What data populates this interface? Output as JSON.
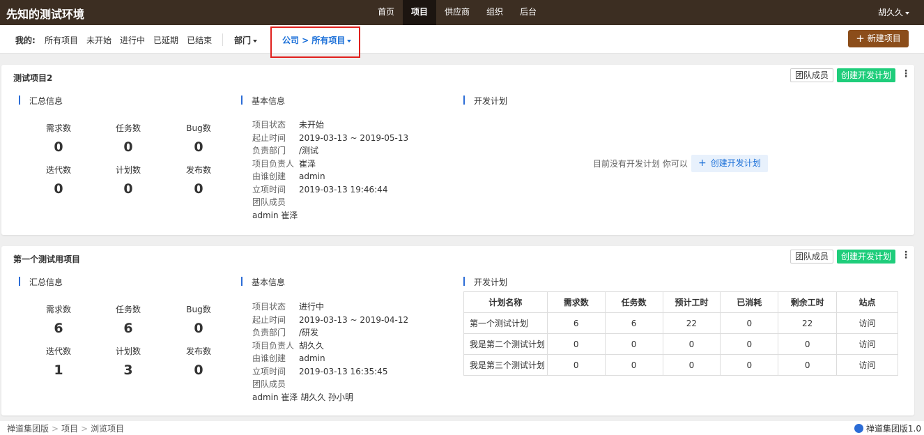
{
  "app": {
    "title": "先知的测试环境",
    "user": "胡久久"
  },
  "nav": {
    "items": [
      "首页",
      "项目",
      "供应商",
      "组织",
      "后台"
    ],
    "active": "项目"
  },
  "subnav": {
    "my_label": "我的:",
    "filters": [
      "所有项目",
      "未开始",
      "进行中",
      "已延期",
      "已结束"
    ],
    "dept": "部门",
    "scope": "公司 > 所有项目",
    "new_button": "新建项目"
  },
  "section_titles": {
    "summary": "汇总信息",
    "basic": "基本信息",
    "plan": "开发计划"
  },
  "buttons": {
    "team": "团队成员",
    "create_plan": "创建开发计划"
  },
  "stat_labels": [
    "需求数",
    "任务数",
    "Bug数",
    "迭代数",
    "计划数",
    "发布数"
  ],
  "info_labels": [
    "项目状态",
    "起止时间",
    "负责部门",
    "项目负责人",
    "由谁创建",
    "立项时间",
    "团队成员"
  ],
  "projects": [
    {
      "name": "测试项目2",
      "stats": [
        "0",
        "0",
        "0",
        "0",
        "0",
        "0"
      ],
      "info": {
        "status": "未开始",
        "period": "2019-03-13 ~ 2019-05-13",
        "dept": "/测试",
        "owner": "崔泽",
        "creator": "admin",
        "created_at": "2019-03-13 19:46:44",
        "members": "admin 崔泽"
      },
      "empty_plan_text": "目前没有开发计划 你可以",
      "empty_plan_button": "创建开发计划"
    },
    {
      "name": "第一个测试用项目",
      "stats": [
        "6",
        "6",
        "0",
        "1",
        "3",
        "0"
      ],
      "info": {
        "status": "进行中",
        "period": "2019-03-13 ~ 2019-04-12",
        "dept": "/研发",
        "owner": "胡久久",
        "creator": "admin",
        "created_at": "2019-03-13 16:35:45",
        "members": "admin 崔泽 胡久久 孙小明"
      },
      "plan_table": {
        "headers": [
          "计划名称",
          "需求数",
          "任务数",
          "预计工时",
          "已消耗",
          "剩余工时",
          "站点"
        ],
        "rows": [
          [
            "第一个测试计划",
            "6",
            "6",
            "22",
            "0",
            "22",
            "访问"
          ],
          [
            "我是第二个测试计划",
            "0",
            "0",
            "0",
            "0",
            "0",
            "访问"
          ],
          [
            "我是第三个测试计划",
            "0",
            "0",
            "0",
            "0",
            "0",
            "访问"
          ]
        ]
      }
    }
  ],
  "footer": {
    "breadcrumbs": [
      "禅道集团版",
      "项目",
      "浏览项目"
    ],
    "version": "禅道集团版1.0"
  },
  "colors": {
    "topbar": "#3c2e22",
    "accent_brown": "#8b4d1a",
    "green": "#1fcd7b",
    "blue": "#1a6fd8",
    "highlight_red": "#e0201d"
  }
}
